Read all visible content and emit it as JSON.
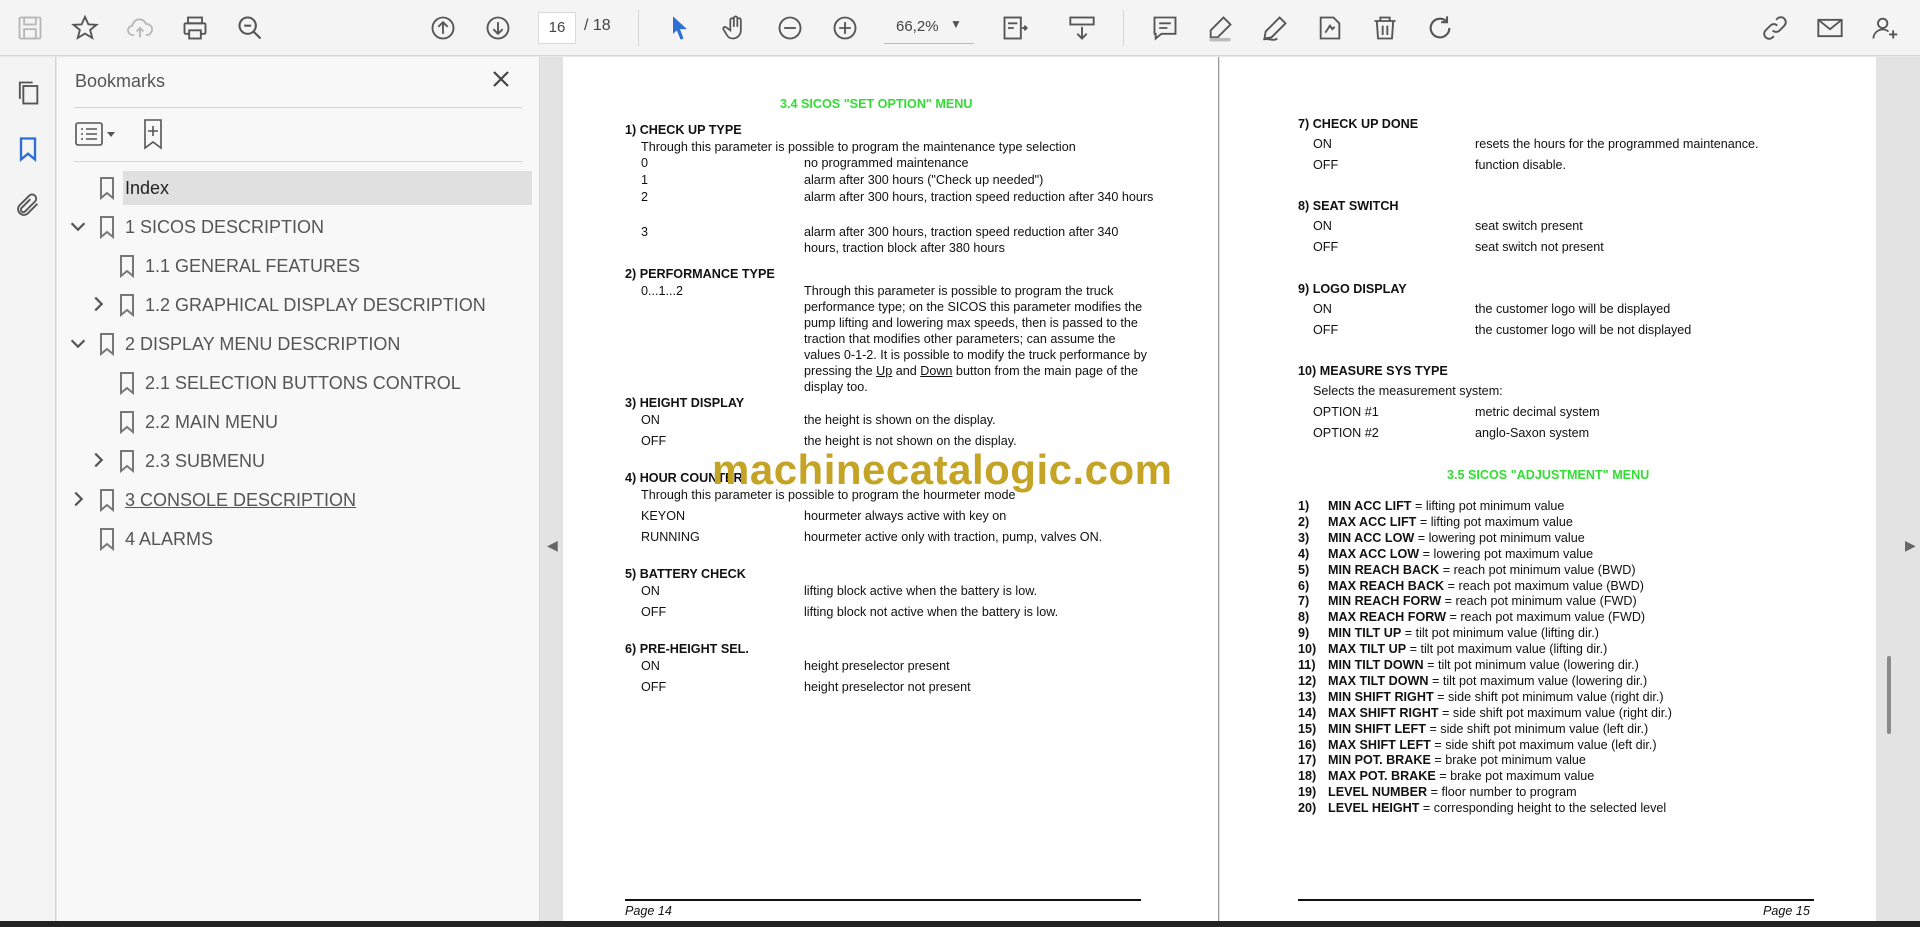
{
  "toolbar": {
    "icons": [
      "save-icon",
      "star-icon",
      "cloud-upload-icon",
      "print-icon",
      "find-icon",
      "page-up-icon",
      "page-down-icon",
      "select-cursor-icon",
      "hand-icon",
      "zoom-out-icon",
      "zoom-in-icon",
      "page-fit-icon",
      "scroll-mode-icon",
      "comment-icon",
      "highlight-icon",
      "draw-icon",
      "sign-icon",
      "delete-icon",
      "rotate-icon",
      "share-link-icon",
      "email-icon",
      "add-user-icon"
    ],
    "current_page": "16",
    "page_total": "/ 18",
    "zoom": "66,2%"
  },
  "bookmarks": {
    "title": "Bookmarks",
    "items": [
      {
        "label": "Index",
        "level": 1,
        "expand": "none",
        "selected": true,
        "underline": false
      },
      {
        "label": "1 SICOS DESCRIPTION",
        "level": 1,
        "expand": "open",
        "selected": false,
        "underline": false
      },
      {
        "label": "1.1 GENERAL FEATURES",
        "level": 2,
        "expand": "none",
        "selected": false,
        "underline": false
      },
      {
        "label": "1.2 GRAPHICAL DISPLAY DESCRIPTION",
        "level": 2,
        "expand": "closed",
        "selected": false,
        "underline": false
      },
      {
        "label": "2 DISPLAY MENU DESCRIPTION",
        "level": 1,
        "expand": "open",
        "selected": false,
        "underline": false
      },
      {
        "label": "2.1 SELECTION BUTTONS CONTROL",
        "level": 2,
        "expand": "none",
        "selected": false,
        "underline": false
      },
      {
        "label": "2.2 MAIN MENU",
        "level": 2,
        "expand": "none",
        "selected": false,
        "underline": false
      },
      {
        "label": "2.3 SUBMENU",
        "level": 2,
        "expand": "closed",
        "selected": false,
        "underline": false
      },
      {
        "label": "3 CONSOLE DESCRIPTION",
        "level": 1,
        "expand": "closed",
        "selected": false,
        "underline": true
      },
      {
        "label": "4 ALARMS",
        "level": 1,
        "expand": "none",
        "selected": false,
        "underline": false
      }
    ]
  },
  "page14": {
    "title": "3.4 SICOS \"SET OPTION\" MENU",
    "s1_head": "1) CHECK UP TYPE",
    "s1_intro": "Through this parameter is possible to program the maintenance type selection",
    "s1_rows": [
      {
        "k": "0",
        "v": "no programmed maintenance"
      },
      {
        "k": "1",
        "v": "alarm after 300 hours (\"Check up needed\")"
      },
      {
        "k": "2",
        "v": "alarm after 300 hours, traction speed reduction after 340 hours"
      },
      {
        "k": "3",
        "v": "alarm after 300 hours, traction speed reduction after 340 hours, traction block after 380 hours"
      }
    ],
    "s2_head": "2) PERFORMANCE TYPE",
    "s2_key": "0...1...2",
    "s2_desc_a": "Through this parameter is possible to program the truck performance type; on the SICOS this parameter modifies the pump lifting and lowering max speeds, then is passed to the traction that modifies other parameters; can assume the values 0-1-2. It is possible to modify the truck performance by pressing the ",
    "s2_up": "Up",
    "s2_and": " and ",
    "s2_down": "Down",
    "s2_desc_b": " button from the main page of the display too.",
    "s3_head": "3) HEIGHT DISPLAY",
    "s3_rows": [
      {
        "k": "ON",
        "v": "the height is shown on the display."
      },
      {
        "k": "OFF",
        "v": "the height is not shown on the display."
      }
    ],
    "s4_head": "4) HOUR COUNTER",
    "s4_intro": "Through this parameter is possible to program the hourmeter mode",
    "s4_rows": [
      {
        "k": "KEYON",
        "v": "hourmeter always active with key on"
      },
      {
        "k": "RUNNING",
        "v": "hourmeter active only with traction, pump, valves ON."
      }
    ],
    "s5_head": "5) BATTERY CHECK",
    "s5_rows": [
      {
        "k": "ON",
        "v": "lifting block active when the battery is low."
      },
      {
        "k": "OFF",
        "v": "lifting block not active when the battery is low."
      }
    ],
    "s6_head": "6) PRE-HEIGHT SEL.",
    "s6_rows": [
      {
        "k": "ON",
        "v": "height preselector present"
      },
      {
        "k": "OFF",
        "v": "height preselector not present"
      }
    ],
    "footer": "Page 14"
  },
  "page15": {
    "s7_head": "7) CHECK UP DONE",
    "s7_rows": [
      {
        "k": "ON",
        "v": "resets the hours for the programmed maintenance."
      },
      {
        "k": "OFF",
        "v": "function disable."
      }
    ],
    "s8_head": "8) SEAT SWITCH",
    "s8_rows": [
      {
        "k": "ON",
        "v": "seat switch present"
      },
      {
        "k": "OFF",
        "v": "seat switch not present"
      }
    ],
    "s9_head": "9) LOGO DISPLAY",
    "s9_rows": [
      {
        "k": "ON",
        "v": "the customer logo will be displayed"
      },
      {
        "k": "OFF",
        "v": "the customer logo will be not displayed"
      }
    ],
    "s10_head": "10) MEASURE SYS TYPE",
    "s10_intro": "Selects the measurement system:",
    "s10_rows": [
      {
        "k": "OPTION #1",
        "v": "metric decimal system"
      },
      {
        "k": "OPTION #2",
        "v": "anglo-Saxon system"
      }
    ],
    "adj_title": "3.5 SICOS \"ADJUSTMENT\" MENU",
    "adj_items": [
      {
        "n": "1)",
        "b": "MIN ACC LIFT",
        "t": " = lifting pot minimum value"
      },
      {
        "n": "2)",
        "b": "MAX ACC LIFT",
        "t": " = lifting pot maximum value"
      },
      {
        "n": "3)",
        "b": "MIN ACC LOW",
        "t": " = lowering pot minimum value"
      },
      {
        "n": "4)",
        "b": "MAX ACC LOW",
        "t": " = lowering pot maximum value"
      },
      {
        "n": "5)",
        "b": "MIN REACH BACK",
        "t": " = reach pot minimum value (BWD)"
      },
      {
        "n": "6)",
        "b": "MAX REACH BACK",
        "t": " = reach pot maximum value (BWD)"
      },
      {
        "n": "7)",
        "b": "MIN REACH FORW",
        "t": " = reach pot minimum value (FWD)"
      },
      {
        "n": "8)",
        "b": "MAX REACH FORW",
        "t": " = reach pot maximum value (FWD)"
      },
      {
        "n": "9)",
        "b": "MIN TILT UP",
        "t": " = tilt pot minimum value (lifting dir.)"
      },
      {
        "n": "10)",
        "b": "MAX TILT UP",
        "t": " = tilt pot maximum value (lifting dir.)"
      },
      {
        "n": "11)",
        "b": "MIN TILT DOWN",
        "t": " = tilt pot minimum value (lowering dir.)"
      },
      {
        "n": "12)",
        "b": "MAX TILT DOWN",
        "t": " = tilt pot maximum value (lowering dir.)"
      },
      {
        "n": "13)",
        "b": "MIN SHIFT RIGHT",
        "t": " = side shift pot minimum value (right dir.)"
      },
      {
        "n": "14)",
        "b": "MAX SHIFT RIGHT",
        "t": " = side shift pot maximum value (right dir.)"
      },
      {
        "n": "15)",
        "b": "MIN SHIFT LEFT",
        "t": " = side shift pot minimum value (left dir.)"
      },
      {
        "n": "16)",
        "b": "MAX SHIFT LEFT",
        "t": " = side shift pot maximum value (left dir.)"
      },
      {
        "n": "17)",
        "b": "MIN POT. BRAKE",
        "t": " = brake pot minimum value"
      },
      {
        "n": "18)",
        "b": "MAX POT. BRAKE",
        "t": " = brake pot maximum value"
      },
      {
        "n": "19)",
        "b": "LEVEL NUMBER",
        "t": " = floor number to program"
      },
      {
        "n": "20)",
        "b": "LEVEL HEIGHT",
        "t": " = corresponding height to the selected level"
      }
    ],
    "footer": "Page 15"
  },
  "watermark": "machinecatalogic.com",
  "colors": {
    "accent": "#2d6fd4",
    "title_green": "#33dd33",
    "watermark": "#c4a325"
  }
}
